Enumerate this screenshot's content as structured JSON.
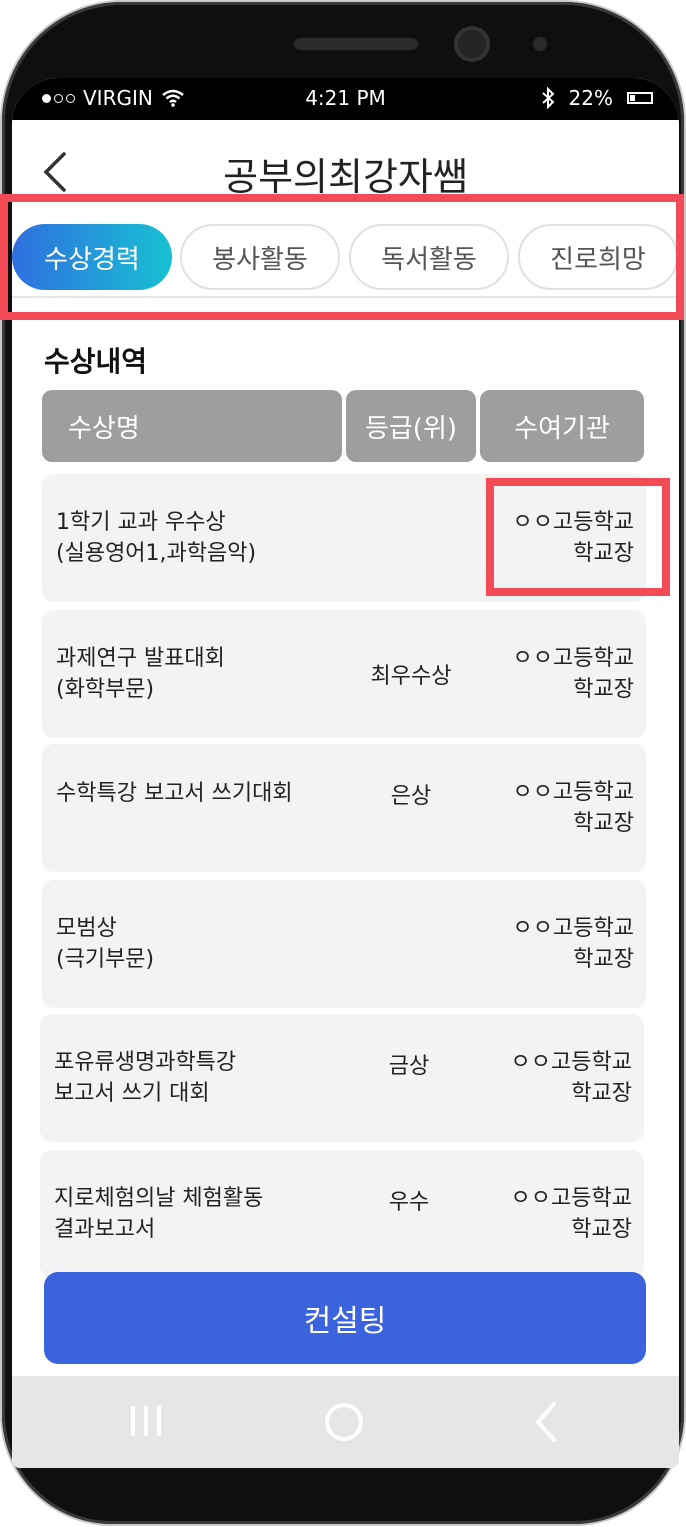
{
  "status": {
    "carrier": "VIRGIN",
    "time": "4:21 PM",
    "battery": "22%"
  },
  "header": {
    "title": "공부의최강자쌤"
  },
  "tabs": [
    {
      "label": "수상경력",
      "active": true
    },
    {
      "label": "봉사활동",
      "active": false
    },
    {
      "label": "독서활동",
      "active": false
    },
    {
      "label": "진로희망",
      "active": false
    }
  ],
  "section": {
    "title": "수상내역"
  },
  "table": {
    "headers": {
      "name": "수상명",
      "grade": "등급(위)",
      "org": "수여기관"
    },
    "rows": [
      {
        "name1": "1학기 교과 우수상",
        "name2": "(실용영어1,과학음악)",
        "grade": "",
        "org1": "ㅇㅇ고등학교",
        "org2": "학교장"
      },
      {
        "name1": "과제연구 발표대회",
        "name2": "(화학부문)",
        "grade": "최우수상",
        "org1": "ㅇㅇ고등학교",
        "org2": "학교장"
      },
      {
        "name1": "수학특강 보고서 쓰기대회",
        "name2": "",
        "grade": "은상",
        "org1": "ㅇㅇ고등학교",
        "org2": "학교장"
      },
      {
        "name1": "모범상",
        "name2": "(극기부문)",
        "grade": "",
        "org1": "ㅇㅇ고등학교",
        "org2": "학교장"
      },
      {
        "name1": "포유류생명과학특강",
        "name2": "보고서 쓰기 대회",
        "grade": "금상",
        "org1": "ㅇㅇ고등학교",
        "org2": "학교장"
      },
      {
        "name1": "지로체험의날 체험활동",
        "name2": "결과보고서",
        "grade": "우수",
        "org1": "ㅇㅇ고등학교",
        "org2": "학교장"
      }
    ]
  },
  "consult_button": {
    "label": "컨설팅"
  },
  "colors": {
    "tab_gradient_start": "#2f6fe0",
    "tab_gradient_end": "#17c1d2",
    "button": "#3b63dd",
    "highlight": "#f24b55",
    "header_cell": "#9e9e9e"
  },
  "icons": {
    "back": "chevron-left-icon",
    "wifi": "wifi-icon",
    "bluetooth": "bluetooth-icon",
    "battery": "battery-icon",
    "recents": "recents-icon",
    "home": "home-icon",
    "nav_back": "back-icon"
  }
}
